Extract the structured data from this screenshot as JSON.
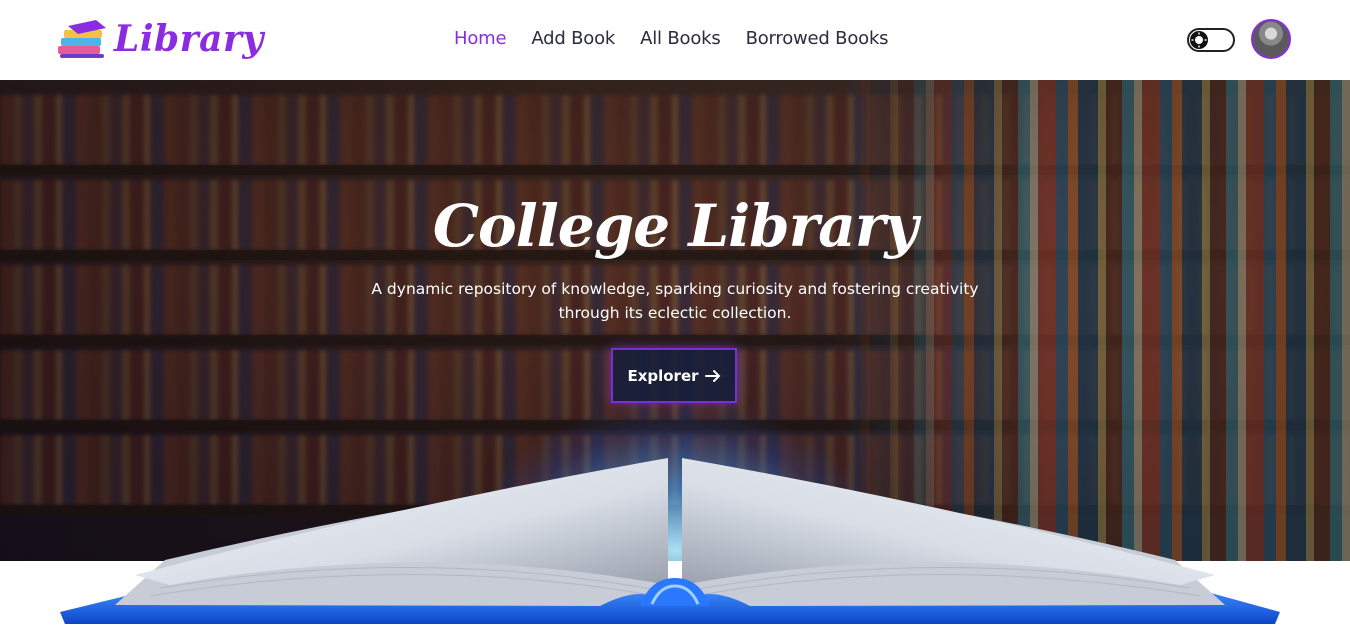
{
  "brand": {
    "name": "Library"
  },
  "nav": {
    "items": [
      {
        "label": "Home",
        "active": true
      },
      {
        "label": "Add Book",
        "active": false
      },
      {
        "label": "All Books",
        "active": false
      },
      {
        "label": "Borrowed Books",
        "active": false
      }
    ]
  },
  "header": {
    "theme_toggle_icon": "theme-toggle-icon",
    "avatar": "user-avatar"
  },
  "hero": {
    "title": "College Library",
    "subtitle": "A dynamic repository of knowledge, sparking curiosity and fostering creativity through its eclectic collection.",
    "cta_label": "Explorer",
    "cta_icon": "arrow-right-icon"
  },
  "colors": {
    "accent": "#8b2ce0",
    "nav_text": "#2c2c40",
    "book_cover": "#1e6ee8"
  }
}
